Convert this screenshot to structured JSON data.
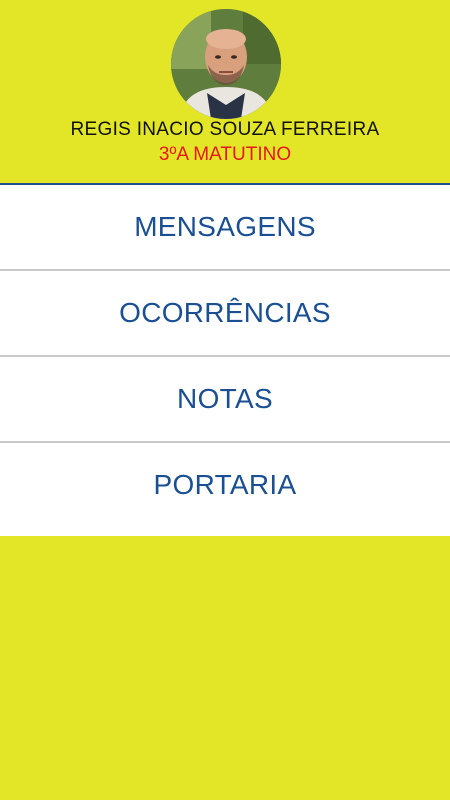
{
  "profile": {
    "name": "REGIS INACIO SOUZA FERREIRA",
    "class": "3ºA MATUTINO"
  },
  "menu": {
    "items": [
      {
        "label": "MENSAGENS"
      },
      {
        "label": "OCORRÊNCIAS"
      },
      {
        "label": "NOTAS"
      },
      {
        "label": "PORTARIA"
      }
    ]
  },
  "colors": {
    "background": "#e3e627",
    "menu_text": "#1b4f93",
    "class_text": "#e8161c",
    "divider": "#c9c9c9"
  }
}
